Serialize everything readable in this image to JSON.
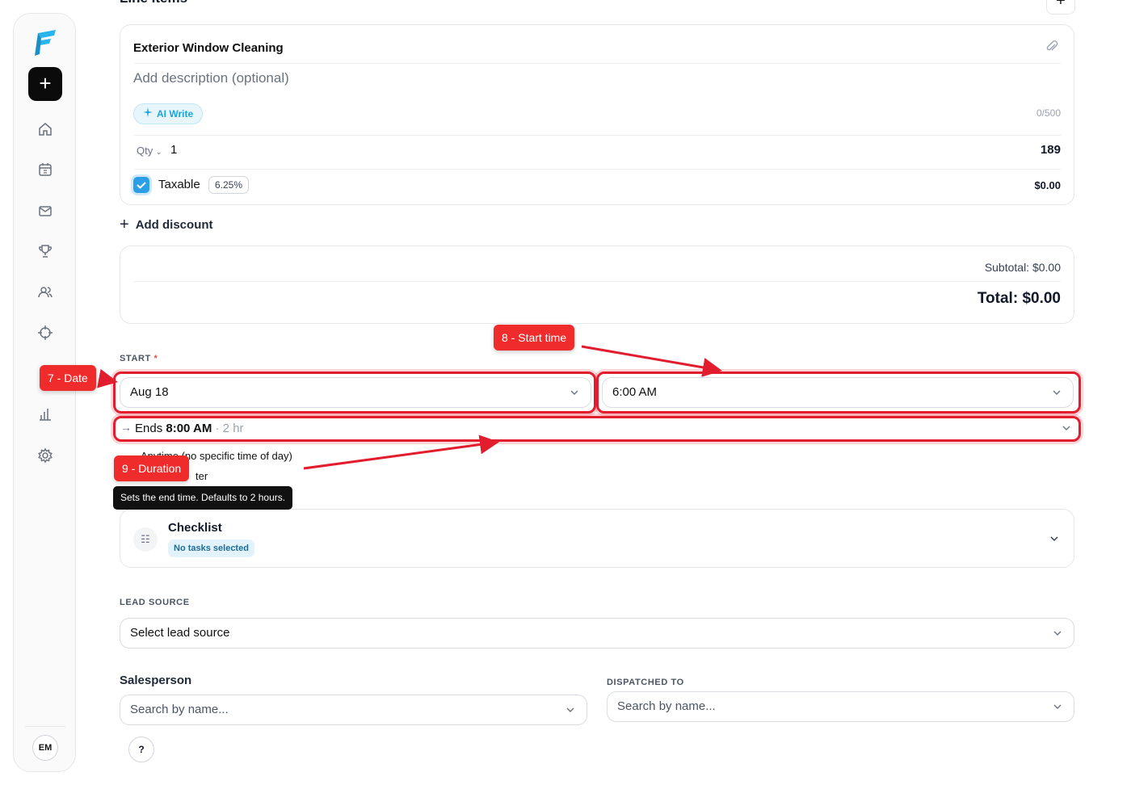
{
  "sidebar": {
    "new_label": "+",
    "avatar_initials": "EM",
    "nav_icons": [
      "home-icon",
      "calendar-icon",
      "mail-icon",
      "trophy-icon",
      "users-icon",
      "crosshair-icon",
      "bar-chart-icon",
      "gear-icon"
    ]
  },
  "line_items": {
    "title": "Line Items",
    "add_label": "+",
    "item": {
      "name": "Exterior Window Cleaning",
      "description_placeholder": "Add description (optional)",
      "ai_write_label": "AI Write",
      "char_count": "0/500",
      "qty_label": "Qty",
      "qty_value": "1",
      "price": "189",
      "taxable_label": "Taxable",
      "taxable_checked": true,
      "tax_rate": "6.25%",
      "tax_amount": "$0.00"
    }
  },
  "discount": {
    "add_label": "Add discount"
  },
  "totals": {
    "subtotal": "Subtotal: $0.00",
    "total": "Total: $0.00"
  },
  "start": {
    "label": "START",
    "required_mark": "*",
    "date": "Aug 18",
    "time": "6:00 AM",
    "ends_prefix": "Ends",
    "ends_time": "8:00 AM",
    "duration": "· 2 hr",
    "option_anytime": "Anytime (no specific time of day)",
    "option_second_partial": "ter"
  },
  "checklist": {
    "title": "Checklist",
    "badge": "No tasks selected"
  },
  "lead_source": {
    "label": "LEAD SOURCE",
    "value": "Select lead source"
  },
  "salesperson": {
    "label": "Salesperson",
    "placeholder": "Search by name..."
  },
  "dispatched_to": {
    "label": "DISPATCHED TO",
    "placeholder": "Search by name..."
  },
  "help_label": "?",
  "annotations": {
    "date_tag": "7 - Date",
    "start_time_tag": "8 - Start time",
    "duration_tag": "9 - Duration",
    "tooltip": "Sets the end time. Defaults to 2 hours."
  },
  "colors": {
    "accent": "#1aa6dc",
    "checkbox": "#2b9fe6",
    "annotation": "#ef2b2b",
    "required": "#ef4444"
  }
}
